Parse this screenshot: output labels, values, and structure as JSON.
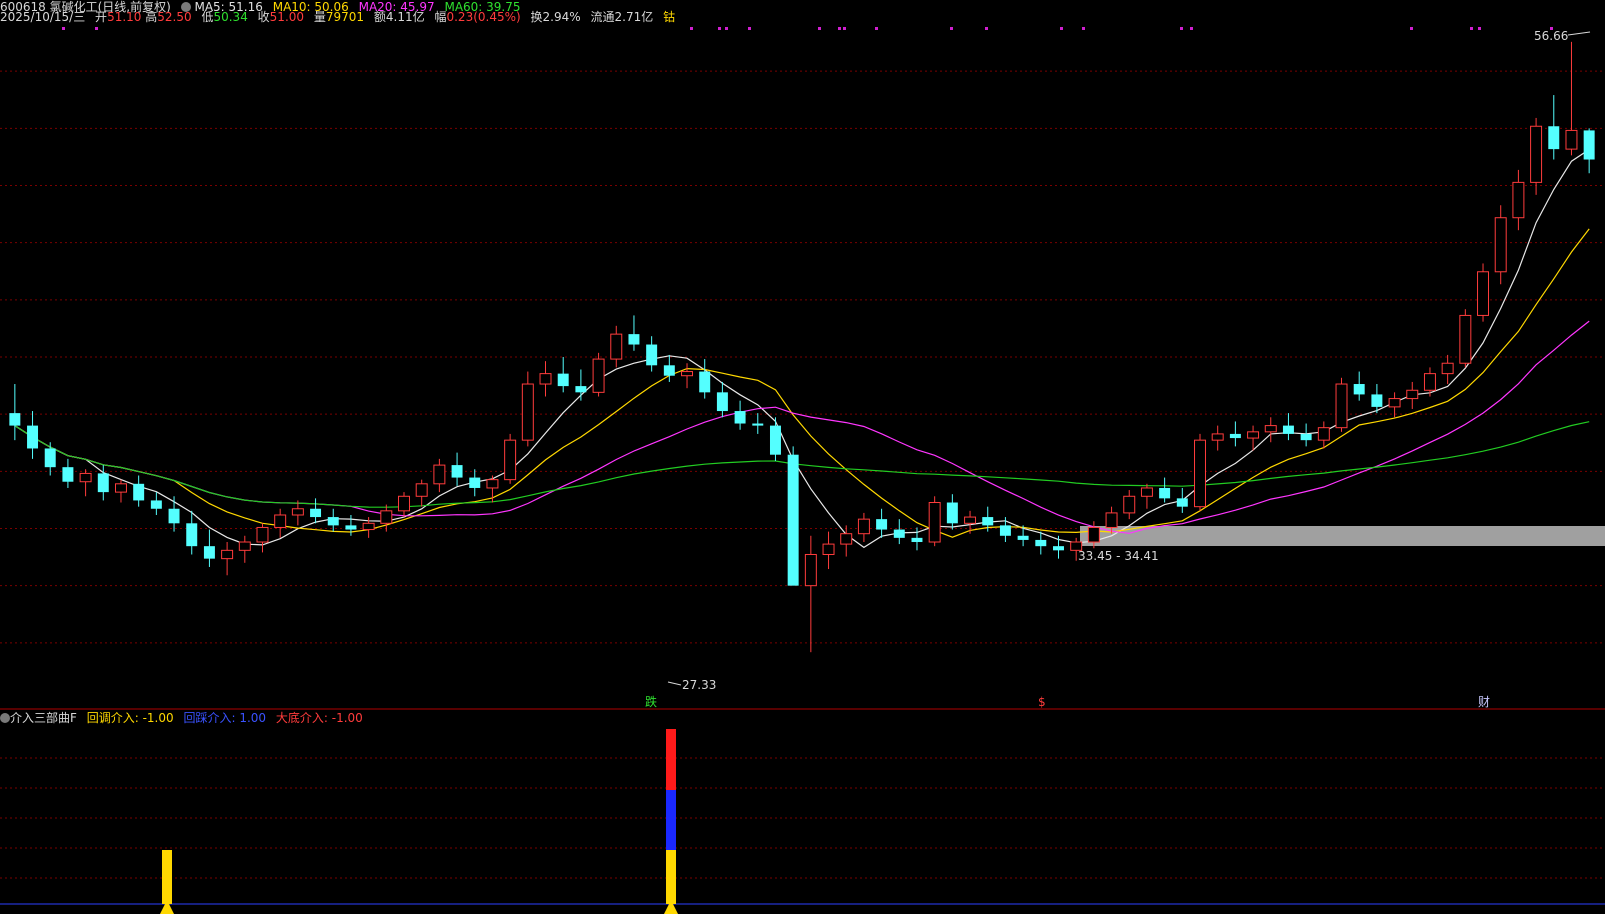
{
  "header": {
    "line1": {
      "stock": "600618 氯碱化工(日线,前复权)",
      "ma5_label": "MA5: 51.16",
      "ma10_label": "MA10: 50.06",
      "ma20_label": "MA20: 45.97",
      "ma60_label": "MA60: 39.75"
    },
    "line2": {
      "date": "2025/10/15/三",
      "open_label": "开",
      "open": "51.10",
      "high_label": "高",
      "high": "52.50",
      "low_label": "低",
      "low": "50.34",
      "close_label": "收",
      "close": "51.00",
      "vol_label": "量",
      "vol": "79701",
      "amt_label": "额",
      "amt": "4.11亿",
      "chg_label": "幅",
      "chg": "0.23(0.45%)",
      "turn_label": "换",
      "turn": "2.94%",
      "float_label": "流通",
      "float": "2.71亿",
      "tag": "钴"
    }
  },
  "annotations": {
    "high_price": "56.66",
    "low_price": "27.33",
    "range_label": "33.45 - 34.41",
    "marker_left": "跌",
    "marker_mid": "$",
    "marker_right": "财"
  },
  "indicator": {
    "name": "介入三部曲F",
    "items": [
      {
        "label": "回调介入: -1.00",
        "color": "#ffd800"
      },
      {
        "label": "回踩介入: 1.00",
        "color": "#3a52ff"
      },
      {
        "label": "大底介入: -1.00",
        "color": "#ff3c3c"
      }
    ]
  },
  "colors": {
    "up": "#ff3c3c",
    "down": "#54ffff",
    "ma5": "#e8e8e8",
    "ma10": "#ffd800",
    "ma20": "#ff36ff",
    "ma60": "#22cc22",
    "grid": "#7a0000",
    "background": "#000000"
  },
  "chart_data": {
    "type": "candlestick",
    "ylim": [
      25,
      58
    ],
    "high_marker": 56.66,
    "low_marker": 27.33,
    "resistance_band": [
      33.45,
      34.41
    ],
    "candles": [
      [
        38.8,
        40.2,
        37.5,
        38.2
      ],
      [
        38.2,
        38.9,
        36.6,
        37.1
      ],
      [
        37.1,
        37.4,
        35.8,
        36.2
      ],
      [
        36.2,
        36.6,
        35.2,
        35.5
      ],
      [
        35.5,
        36.1,
        34.8,
        35.9
      ],
      [
        35.9,
        36.3,
        34.6,
        35.0
      ],
      [
        35.0,
        35.6,
        34.5,
        35.4
      ],
      [
        35.4,
        35.8,
        34.3,
        34.6
      ],
      [
        34.6,
        35.0,
        33.9,
        34.2
      ],
      [
        34.2,
        34.8,
        33.1,
        33.5
      ],
      [
        33.5,
        34.1,
        32.0,
        32.4
      ],
      [
        32.4,
        33.2,
        31.4,
        31.8
      ],
      [
        31.8,
        32.6,
        31.0,
        32.2
      ],
      [
        32.2,
        32.9,
        31.6,
        32.6
      ],
      [
        32.6,
        33.5,
        32.1,
        33.3
      ],
      [
        33.3,
        34.2,
        32.8,
        33.9
      ],
      [
        33.9,
        34.6,
        33.4,
        34.2
      ],
      [
        34.2,
        34.7,
        33.5,
        33.8
      ],
      [
        33.8,
        34.2,
        33.1,
        33.4
      ],
      [
        33.4,
        33.9,
        32.9,
        33.2
      ],
      [
        33.2,
        33.8,
        32.8,
        33.5
      ],
      [
        33.5,
        34.4,
        33.1,
        34.1
      ],
      [
        34.1,
        35.0,
        33.8,
        34.8
      ],
      [
        34.8,
        35.6,
        34.3,
        35.4
      ],
      [
        35.4,
        36.6,
        35.0,
        36.3
      ],
      [
        36.3,
        36.9,
        35.3,
        35.7
      ],
      [
        35.7,
        36.1,
        34.8,
        35.2
      ],
      [
        35.2,
        35.8,
        34.5,
        35.6
      ],
      [
        35.6,
        37.8,
        35.4,
        37.5
      ],
      [
        37.5,
        40.8,
        37.2,
        40.2
      ],
      [
        40.2,
        41.3,
        39.6,
        40.7
      ],
      [
        40.7,
        41.5,
        39.8,
        40.1
      ],
      [
        40.1,
        40.9,
        39.4,
        39.8
      ],
      [
        39.8,
        41.7,
        39.6,
        41.4
      ],
      [
        41.4,
        43.0,
        41.0,
        42.6
      ],
      [
        42.6,
        43.5,
        41.8,
        42.1
      ],
      [
        42.1,
        42.5,
        40.8,
        41.1
      ],
      [
        41.1,
        41.6,
        40.3,
        40.6
      ],
      [
        40.6,
        41.2,
        40.0,
        40.8
      ],
      [
        40.8,
        41.4,
        39.5,
        39.8
      ],
      [
        39.8,
        40.3,
        38.6,
        38.9
      ],
      [
        38.9,
        39.4,
        38.0,
        38.3
      ],
      [
        38.3,
        38.8,
        37.8,
        38.2
      ],
      [
        38.2,
        38.6,
        36.5,
        36.8
      ],
      [
        36.8,
        37.2,
        30.8,
        30.5
      ],
      [
        30.5,
        32.9,
        27.3,
        32.0
      ],
      [
        32.0,
        33.1,
        31.3,
        32.5
      ],
      [
        32.5,
        33.4,
        31.9,
        33.0
      ],
      [
        33.0,
        34.0,
        32.6,
        33.7
      ],
      [
        33.7,
        34.2,
        32.8,
        33.2
      ],
      [
        33.2,
        33.7,
        32.5,
        32.8
      ],
      [
        32.8,
        33.3,
        32.2,
        32.6
      ],
      [
        32.6,
        34.8,
        32.4,
        34.5
      ],
      [
        34.5,
        34.9,
        33.2,
        33.5
      ],
      [
        33.5,
        34.1,
        33.0,
        33.8
      ],
      [
        33.8,
        34.3,
        33.1,
        33.4
      ],
      [
        33.4,
        33.8,
        32.6,
        32.9
      ],
      [
        32.9,
        33.4,
        32.4,
        32.7
      ],
      [
        32.7,
        33.1,
        32.0,
        32.4
      ],
      [
        32.4,
        32.9,
        31.8,
        32.2
      ],
      [
        32.2,
        32.8,
        31.7,
        32.6
      ],
      [
        32.6,
        33.6,
        32.3,
        33.3
      ],
      [
        33.3,
        34.3,
        33.0,
        34.0
      ],
      [
        34.0,
        35.1,
        33.7,
        34.8
      ],
      [
        34.8,
        35.4,
        34.2,
        35.2
      ],
      [
        35.2,
        35.7,
        34.5,
        34.7
      ],
      [
        34.7,
        35.2,
        34.0,
        34.3
      ],
      [
        34.3,
        37.8,
        34.1,
        37.5
      ],
      [
        37.5,
        38.2,
        37.0,
        37.8
      ],
      [
        37.8,
        38.4,
        37.2,
        37.6
      ],
      [
        37.6,
        38.2,
        37.0,
        37.9
      ],
      [
        37.9,
        38.6,
        37.4,
        38.2
      ],
      [
        38.2,
        38.8,
        37.5,
        37.8
      ],
      [
        37.8,
        38.3,
        37.2,
        37.5
      ],
      [
        37.5,
        38.4,
        37.1,
        38.1
      ],
      [
        38.1,
        40.5,
        37.9,
        40.2
      ],
      [
        40.2,
        40.8,
        39.4,
        39.7
      ],
      [
        39.7,
        40.2,
        38.8,
        39.1
      ],
      [
        39.1,
        39.8,
        38.6,
        39.5
      ],
      [
        39.5,
        40.3,
        39.0,
        39.9
      ],
      [
        39.9,
        41.0,
        39.6,
        40.7
      ],
      [
        40.7,
        41.6,
        40.2,
        41.2
      ],
      [
        41.2,
        43.8,
        41.0,
        43.5
      ],
      [
        43.5,
        46.0,
        43.2,
        45.6
      ],
      [
        45.6,
        48.8,
        45.0,
        48.2
      ],
      [
        48.2,
        50.5,
        47.6,
        49.9
      ],
      [
        49.9,
        53.0,
        49.3,
        52.6
      ],
      [
        52.6,
        54.1,
        51.0,
        51.5
      ],
      [
        51.5,
        56.66,
        51.2,
        52.4
      ],
      [
        52.4,
        52.5,
        50.34,
        51.0
      ]
    ]
  }
}
